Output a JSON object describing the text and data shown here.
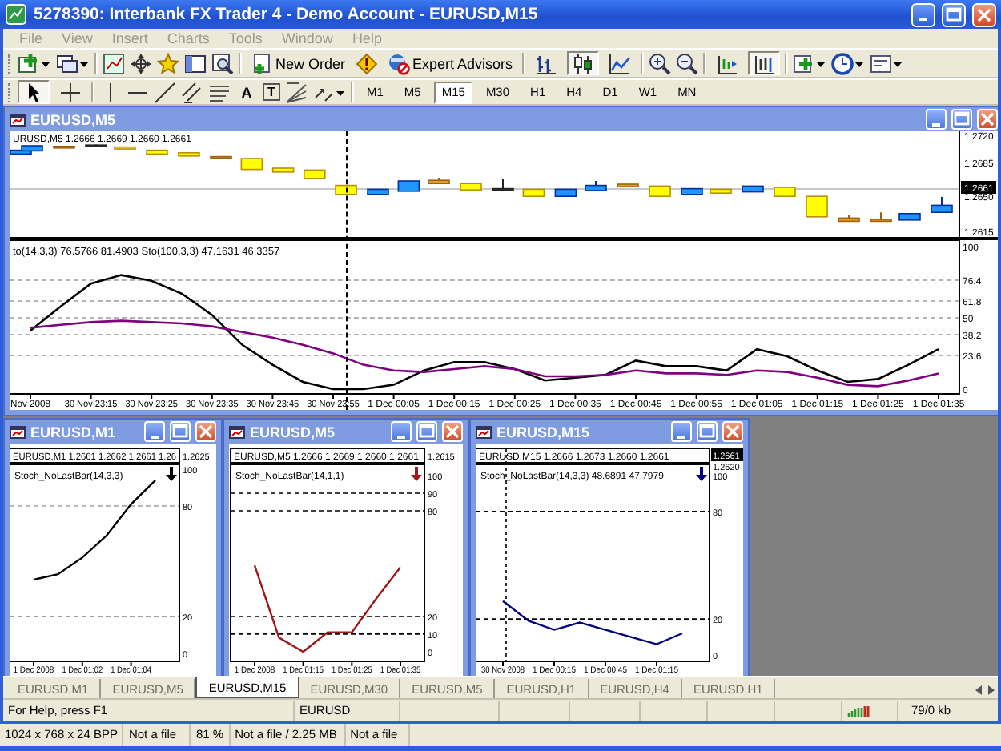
{
  "window": {
    "title": "5278390: Interbank FX Trader 4 - Demo Account - EURUSD,M15"
  },
  "menu": [
    "File",
    "View",
    "Insert",
    "Charts",
    "Tools",
    "Window",
    "Help"
  ],
  "toolbar": {
    "new_order": "New Order",
    "expert_advisors": "Expert Advisors",
    "chart_types": [
      {
        "pressed": false
      },
      {
        "pressed": true
      },
      {
        "pressed": false
      }
    ],
    "chart_shift": {
      "pressed": false
    },
    "auto_scroll": {
      "pressed": true
    }
  },
  "drawing_tools": {
    "cursor": {
      "pressed": true
    },
    "crosshair": {
      "pressed": false
    },
    "text_tool": "A",
    "label_tool": "T"
  },
  "timeframes": [
    {
      "label": "M1",
      "selected": false
    },
    {
      "label": "M5",
      "selected": false
    },
    {
      "label": "M15",
      "selected": true
    },
    {
      "label": "M30",
      "selected": false
    },
    {
      "label": "H1",
      "selected": false
    },
    {
      "label": "H4",
      "selected": false
    },
    {
      "label": "D1",
      "selected": false
    },
    {
      "label": "W1",
      "selected": false
    },
    {
      "label": "MN",
      "selected": false
    }
  ],
  "main_chart": {
    "title": "EURUSD,M5",
    "price_header": "URUSD,M5  1.2666 1.2669 1.2660 1.2661",
    "price_axis": [
      "1.2720",
      "1.2685",
      "1.2650",
      "1.2615"
    ],
    "current_price": "1.2661",
    "indicator_header": "to(14,3,3) 76.5766 81.4903  Sto(100,3,3) 47.1631 46.3357",
    "chart_data": {
      "type": "line",
      "categories": [
        "Nov 2008",
        null,
        "30 Nov 23:15",
        null,
        "30 Nov 23:25",
        null,
        "30 Nov 23:35",
        null,
        "30 Nov 23:45",
        null,
        "30 Nov 23:55",
        null,
        "1 Dec 00:05",
        null,
        "1 Dec 00:15",
        null,
        "1 Dec 00:25",
        null,
        "1 Dec 00:35",
        null,
        "1 Dec 00:45",
        null,
        "1 Dec 00:55",
        null,
        "1 Dec 01:05",
        null,
        "1 Dec 01:15",
        null,
        "1 Dec 01:25",
        null,
        "1 Dec 01:35"
      ],
      "ylim": [
        -3.4,
        104.5
      ],
      "grid": true,
      "yticks": [
        100,
        76.4,
        61.8,
        50,
        38.2,
        23.6,
        0
      ],
      "series": [
        {
          "color": "#000000",
          "values": [
            41,
            58,
            74,
            80,
            76,
            67,
            52,
            31,
            17,
            5,
            0,
            0,
            3,
            13,
            19,
            19,
            14,
            6,
            8,
            10,
            20,
            16,
            16,
            13,
            28,
            23,
            13,
            5,
            7,
            17,
            28
          ]
        },
        {
          "color": "#800080",
          "values": [
            43,
            45,
            47,
            48,
            47,
            46,
            44,
            40,
            36,
            31,
            25,
            17,
            13,
            12,
            14,
            16,
            14,
            9,
            9,
            10,
            13,
            11,
            11,
            10,
            13,
            12,
            8,
            3,
            2,
            6,
            11
          ]
        }
      ]
    }
  },
  "small_charts": [
    {
      "title": "EURUSD,M1",
      "price_header": "EURUSD,M1  1.2661 1.2662 1.2661 1.26",
      "price_axis": [
        "1.2625"
      ],
      "indicator_header": "Stoch_NoLastBar(14,3,3)",
      "chart_data": {
        "type": "line",
        "categories": [
          "1 Dec 2008",
          null,
          "1 Dec 01:02",
          null,
          "1 Dec 01:04",
          null
        ],
        "ylim": [
          -4.3,
          102.6
        ],
        "grid": true,
        "yticks": [
          100,
          80,
          20,
          0
        ],
        "series": [
          {
            "color": "#000000",
            "values": [
              40,
              43,
              52,
              64,
              81,
              94
            ]
          }
        ]
      }
    },
    {
      "title": "EURUSD,M5",
      "price_header": "EURUSD,M5  1.2666 1.2669 1.2660 1.2661",
      "price_axis": [
        "1.2615"
      ],
      "indicator_header": "Stoch_NoLastBar(14,1,1)",
      "chart_data": {
        "type": "line",
        "categories": [
          "1 Dec 2008",
          null,
          "1 Dec 01:15",
          null,
          "1 Dec 01:25",
          null,
          "1 Dec 01:35"
        ],
        "ylim": [
          -5.5,
          106.4
        ],
        "grid": true,
        "yticks": [
          100,
          90,
          80,
          20,
          10,
          0
        ],
        "series": [
          {
            "color": "#a01818",
            "values": [
              49,
              8,
              0,
              11,
              11,
              30,
              48
            ]
          }
        ]
      }
    },
    {
      "title": "EURUSD,M15",
      "price_header": "EURUSD,M15  1.2666 1.2673 1.2660 1.2661",
      "price_axis": [
        "1.2620"
      ],
      "current_price": "1.2661",
      "indicator_header": "Stoch_NoLastBar(14,3,3) 48.6891 47.7979",
      "chart_data": {
        "type": "line",
        "categories": [
          "30 Nov 2008",
          null,
          "1 Dec 00:15",
          null,
          "1 Dec 00:45",
          null,
          "1 Dec 01:15",
          null
        ],
        "ylim": [
          -3.6,
          106.3
        ],
        "grid": true,
        "yticks": [
          100,
          80,
          20,
          0
        ],
        "series": [
          {
            "color": "#000080",
            "values": [
              30,
              19,
              14,
              18,
              14,
              10,
              6,
              12
            ]
          }
        ]
      }
    }
  ],
  "tabs": [
    {
      "label": "EURUSD,M1",
      "selected": false
    },
    {
      "label": "EURUSD,M5",
      "selected": false
    },
    {
      "label": "EURUSD,M15",
      "selected": true
    },
    {
      "label": "EURUSD,M30",
      "selected": false
    },
    {
      "label": "EURUSD,M5",
      "selected": false
    },
    {
      "label": "EURUSD,H1",
      "selected": false
    },
    {
      "label": "EURUSD,H4",
      "selected": false
    },
    {
      "label": "EURUSD,H1",
      "selected": false
    }
  ],
  "status_bar": {
    "help": "For Help, press F1",
    "symbol": "EURUSD",
    "traffic": "79/0 kb"
  },
  "viewer_status": [
    "1024 x 768 x 24 BPP",
    "Not a file",
    "81 %",
    "Not a file / 2.25 MB",
    "Not a file"
  ]
}
